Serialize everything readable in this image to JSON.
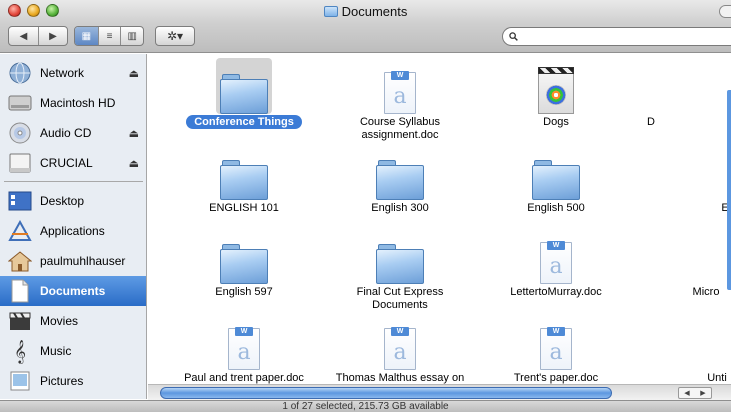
{
  "window": {
    "title": "Documents",
    "status": "1 of 27 selected, 215.73 GB available"
  },
  "toolbar": {
    "back_label": "◀",
    "forward_label": "▶",
    "view_icon_label": "▦",
    "view_list_label": "≡",
    "view_column_label": "▥",
    "action_label": "✲▾",
    "search_icon": "magnifier-icon",
    "search_value": ""
  },
  "sidebar": {
    "devices": [
      {
        "label": "Network",
        "icon": "network-globe-icon",
        "eject": true
      },
      {
        "label": "Macintosh HD",
        "icon": "hard-drive-icon",
        "eject": false
      },
      {
        "label": "Audio CD",
        "icon": "cd-icon",
        "eject": true
      },
      {
        "label": "CRUCIAL",
        "icon": "external-drive-icon",
        "eject": true
      }
    ],
    "places": [
      {
        "label": "Desktop",
        "icon": "desktop-icon",
        "selected": false
      },
      {
        "label": "Applications",
        "icon": "applications-icon",
        "selected": false
      },
      {
        "label": "paulmuhlhauser",
        "icon": "home-icon",
        "selected": false
      },
      {
        "label": "Documents",
        "icon": "documents-icon",
        "selected": true
      },
      {
        "label": "Movies",
        "icon": "movies-icon",
        "selected": false
      },
      {
        "label": "Music",
        "icon": "music-icon",
        "selected": false
      },
      {
        "label": "Pictures",
        "icon": "pictures-icon",
        "selected": false
      }
    ],
    "eject_glyph": "⏏"
  },
  "files": [
    {
      "name": "Conference Things",
      "kind": "folder",
      "selected": true
    },
    {
      "name": "Course Syllabus assignment.doc",
      "kind": "word-doc",
      "selected": false
    },
    {
      "name": "Dogs",
      "kind": "movie",
      "selected": false
    },
    {
      "name": "D",
      "kind": "partial",
      "selected": false
    },
    {
      "name": "ENGLISH 101",
      "kind": "folder",
      "selected": false
    },
    {
      "name": "English 300",
      "kind": "folder",
      "selected": false
    },
    {
      "name": "English 500",
      "kind": "folder",
      "selected": false
    },
    {
      "name": "E",
      "kind": "partial",
      "selected": false
    },
    {
      "name": "English 597",
      "kind": "folder",
      "selected": false
    },
    {
      "name": "Final Cut Express Documents",
      "kind": "folder",
      "selected": false
    },
    {
      "name": "LettertoMurray.doc",
      "kind": "word-doc",
      "selected": false
    },
    {
      "name": "Micro",
      "kind": "partial",
      "selected": false
    },
    {
      "name": "Paul and trent paper.doc",
      "kind": "word-doc",
      "selected": false
    },
    {
      "name": "Thomas Malthus essay on",
      "kind": "word-doc",
      "selected": false
    },
    {
      "name": "Trent's paper.doc",
      "kind": "word-doc",
      "selected": false
    },
    {
      "name": "Unti",
      "kind": "partial",
      "selected": false
    }
  ],
  "colors": {
    "selection": "#3b7bd6",
    "sidebar_bg": "#e8edf3",
    "sidebar_selected": "#2a6cc7"
  }
}
